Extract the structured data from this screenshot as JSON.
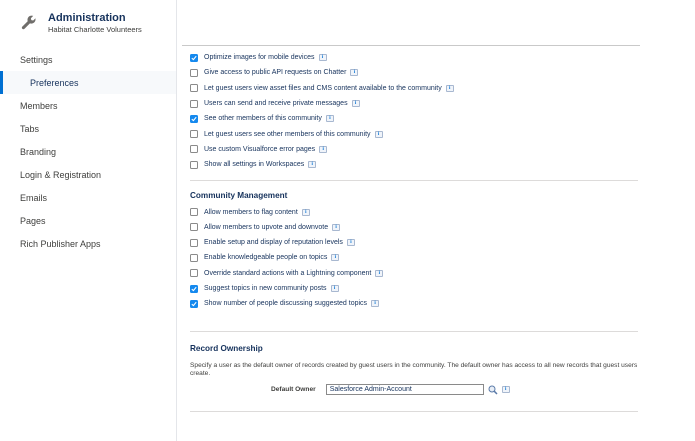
{
  "header": {
    "title": "Administration",
    "subtitle": "Habitat Charlotte Volunteers"
  },
  "sidebar": {
    "items": [
      {
        "label": "Settings",
        "active": false
      },
      {
        "label": "Preferences",
        "active": true
      },
      {
        "label": "Members",
        "active": false
      },
      {
        "label": "Tabs",
        "active": false
      },
      {
        "label": "Branding",
        "active": false
      },
      {
        "label": "Login & Registration",
        "active": false
      },
      {
        "label": "Emails",
        "active": false
      },
      {
        "label": "Pages",
        "active": false
      },
      {
        "label": "Rich Publisher Apps",
        "active": false
      }
    ]
  },
  "general_options": [
    {
      "label": "Optimize images for mobile devices",
      "checked": true
    },
    {
      "label": "Give access to public API requests on Chatter",
      "checked": false
    },
    {
      "label": "Let guest users view asset files and CMS content available to the community",
      "checked": false
    },
    {
      "label": "Users can send and receive private messages",
      "checked": false
    },
    {
      "label": "See other members of this community",
      "checked": true
    },
    {
      "label": "Let guest users see other members of this community",
      "checked": false
    },
    {
      "label": "Use custom Visualforce error pages",
      "checked": false
    },
    {
      "label": "Show all settings in Workspaces",
      "checked": false
    }
  ],
  "community_management": {
    "title": "Community Management",
    "options": [
      {
        "label": "Allow members to flag content",
        "checked": false
      },
      {
        "label": "Allow members to upvote and downvote",
        "checked": false
      },
      {
        "label": "Enable setup and display of reputation levels",
        "checked": false
      },
      {
        "label": "Enable knowledgeable people on topics",
        "checked": false
      },
      {
        "label": "Override standard actions with a Lightning component",
        "checked": false
      },
      {
        "label": "Suggest topics in new community posts",
        "checked": true
      },
      {
        "label": "Show number of people discussing suggested topics",
        "checked": true
      }
    ]
  },
  "record_ownership": {
    "title": "Record Ownership",
    "description": "Specify a user as the default owner of records created by guest users in the community. The default owner has access to all new records that guest users create.",
    "owner_label": "Default Owner",
    "owner_value": "Salesforce Admin-Account"
  },
  "info_glyph": "i",
  "colors": {
    "accent": "#0070d2",
    "checkbox_checked": "#1589ee"
  }
}
